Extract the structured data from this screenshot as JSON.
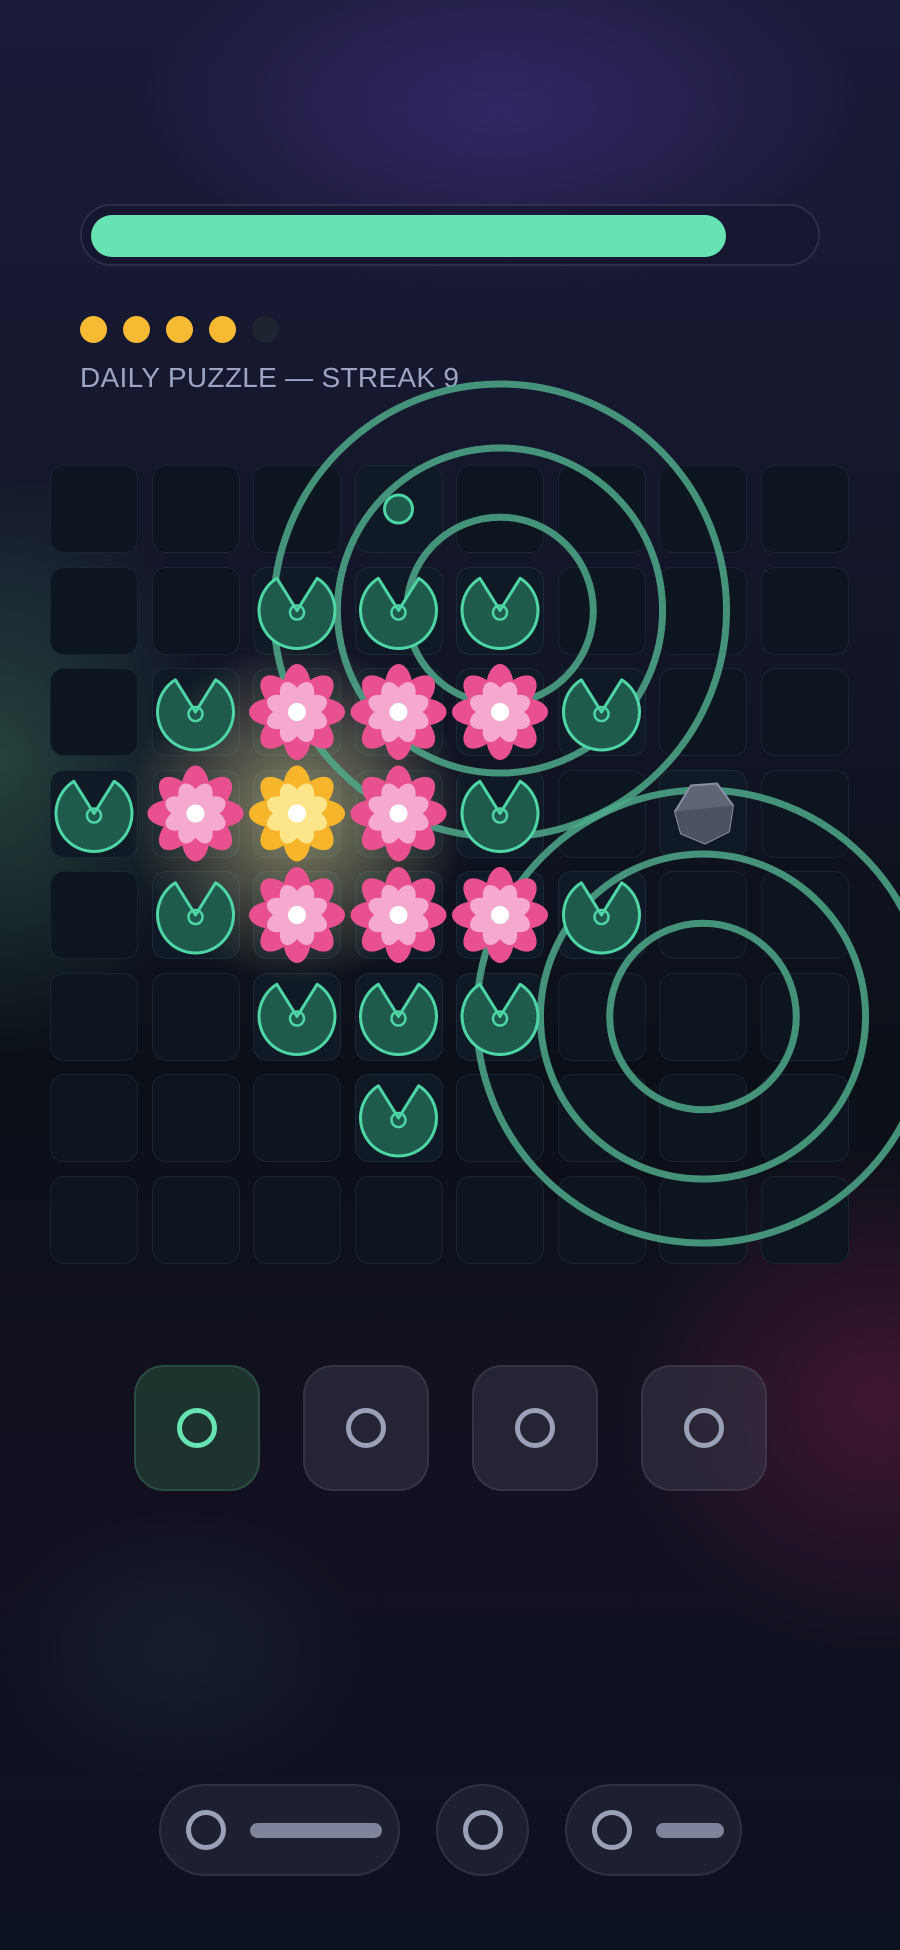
{
  "progress": {
    "fraction": 0.89,
    "track_color": "#1a1a33",
    "fill_color": "#66e3b2"
  },
  "lives": {
    "filled": 4,
    "total": 5,
    "filled_color": "#f6bb32",
    "empty_color": "#1e2330"
  },
  "subtitle": "DAILY PUZZLE — STREAK 9",
  "board": {
    "cols": 8,
    "rows": 8,
    "grid": [
      ". . . p . . . .",
      ". . P P P . . .",
      ". P F F F P . .",
      "P F G F P . R .",
      ". P F F F P . .",
      ". . P P P . . .",
      ". . . P . . . .",
      ". . . . . . . ."
    ],
    "legend": {
      "P": "lily-pad",
      "F": "pink-lotus",
      "G": "golden-lotus",
      "p": "seed",
      "R": "stone",
      ".": "empty"
    },
    "colors": {
      "pad": "#1f5b4d",
      "pad_edge": "#4fd6a5",
      "pink_outer": "#e8508f",
      "pink_inner": "#f6a9ce",
      "gold_outer": "#f6b52a",
      "gold_inner": "#fde58a",
      "ripple": "#4fa989",
      "stone": "#5f6477"
    },
    "ripples": [
      {
        "center_cell": [
          1,
          4
        ],
        "radius_cells": [
          0.5,
          1.15,
          1.75
        ]
      },
      {
        "center_cell": [
          5,
          6
        ],
        "radius_cells": [
          0.5,
          1.15,
          1.75
        ]
      }
    ]
  },
  "tools": [
    {
      "name": "tool-1",
      "icon": "ring-icon",
      "active": true
    },
    {
      "name": "tool-2",
      "icon": "ring-icon",
      "active": false
    },
    {
      "name": "tool-3",
      "icon": "ring-icon",
      "active": false
    },
    {
      "name": "tool-4",
      "icon": "ring-icon",
      "active": false
    }
  ],
  "bottom_controls": [
    {
      "name": "control-left",
      "icon": "ring-icon",
      "bar": true
    },
    {
      "name": "control-center",
      "icon": "ring-icon",
      "bar": false
    },
    {
      "name": "control-right",
      "icon": "ring-icon",
      "bar": true
    }
  ]
}
